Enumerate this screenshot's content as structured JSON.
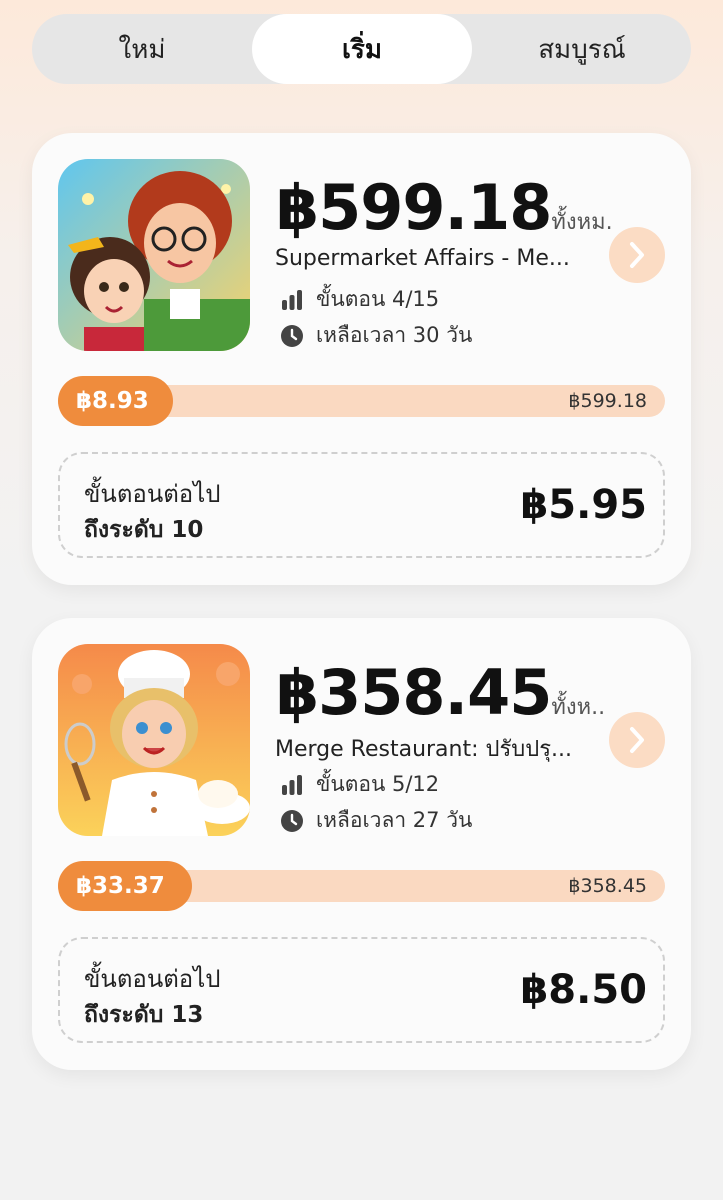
{
  "tabs": [
    {
      "label": "ใหม่",
      "active": false
    },
    {
      "label": "เริ่ม",
      "active": true
    },
    {
      "label": "สมบูรณ์",
      "active": false
    }
  ],
  "colors": {
    "accent": "#ef8c3d",
    "accent_light": "#fad9c1",
    "arrow_bg": "#fbdcc4"
  },
  "cards": [
    {
      "amount": "฿599.18",
      "total_suffix": "ทั้งหม.",
      "title": "Supermarket Affairs - Me...",
      "steps": "ขั้นตอน 4/15",
      "time_left": "เหลือเวลา 30 วัน",
      "earned": "฿8.93",
      "earned_fraction": 0.19,
      "total": "฿599.18",
      "next_label": "ขั้นตอนต่อไป",
      "next_level": "ถึงระดับ 10",
      "next_reward": "฿5.95",
      "icons": {
        "steps": "bar-chart-icon",
        "time": "clock-icon",
        "arrow": "chevron-right-icon"
      }
    },
    {
      "amount": "฿358.45",
      "total_suffix": "ทั้งห..",
      "title": "Merge Restaurant: ปรับปรุ...",
      "steps": "ขั้นตอน 5/12",
      "time_left": "เหลือเวลา 27 วัน",
      "earned": "฿33.37",
      "earned_fraction": 0.22,
      "total": "฿358.45",
      "next_label": "ขั้นตอนต่อไป",
      "next_level": "ถึงระดับ 13",
      "next_reward": "฿8.50",
      "icons": {
        "steps": "bar-chart-icon",
        "time": "clock-icon",
        "arrow": "chevron-right-icon"
      }
    }
  ]
}
